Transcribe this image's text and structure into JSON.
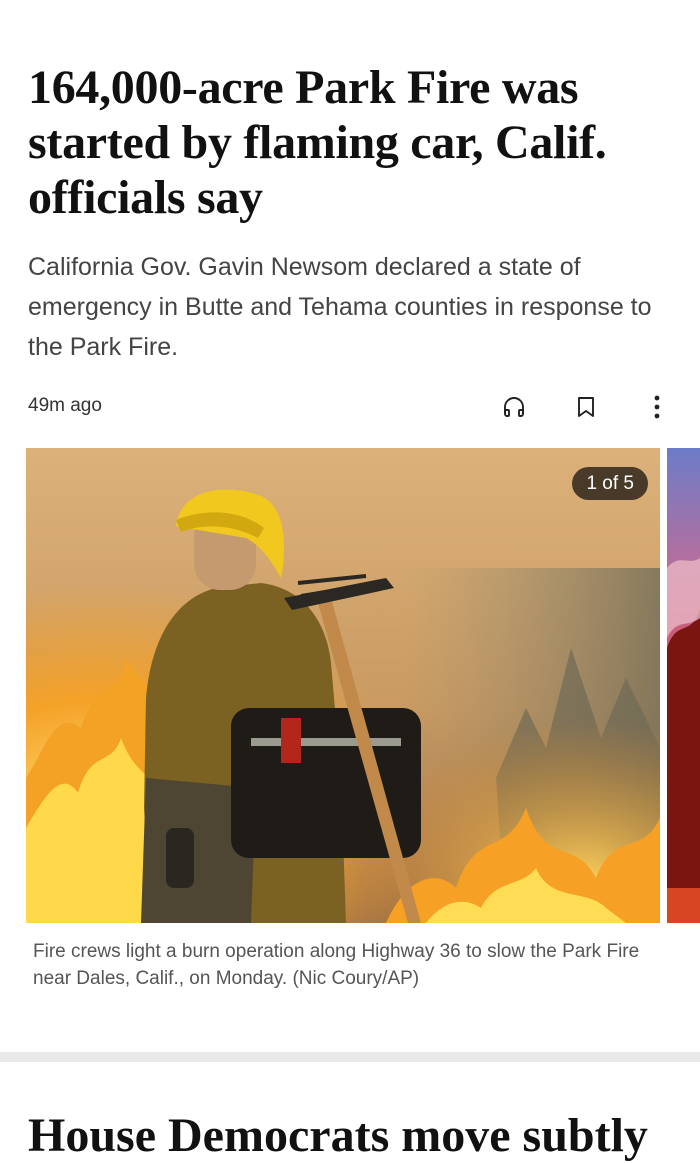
{
  "article": {
    "headline": "164,000-acre Park Fire was started by flaming car, Calif. officials say",
    "dek": "California Gov. Gavin Newsom declared a state of emergency in Butte and Tehama counties in response to the Park Fire.",
    "timestamp": "49m ago",
    "actions": [
      {
        "icon": "headphones-icon"
      },
      {
        "icon": "bookmark-icon"
      },
      {
        "icon": "more-vertical-icon"
      }
    ]
  },
  "gallery": {
    "counter": "1 of 5",
    "caption": "Fire crews light a burn operation along Highway 36 to slow the Park Fire near Dales, Calif., on Monday. (Nic Coury/AP)"
  },
  "next_article": {
    "headline": "House Democrats move subtly"
  },
  "colors": {
    "text": "#111111",
    "dek": "#444444",
    "caption": "#555555",
    "divider": "#e9e9e9",
    "counter_bg": "#2b2119"
  }
}
